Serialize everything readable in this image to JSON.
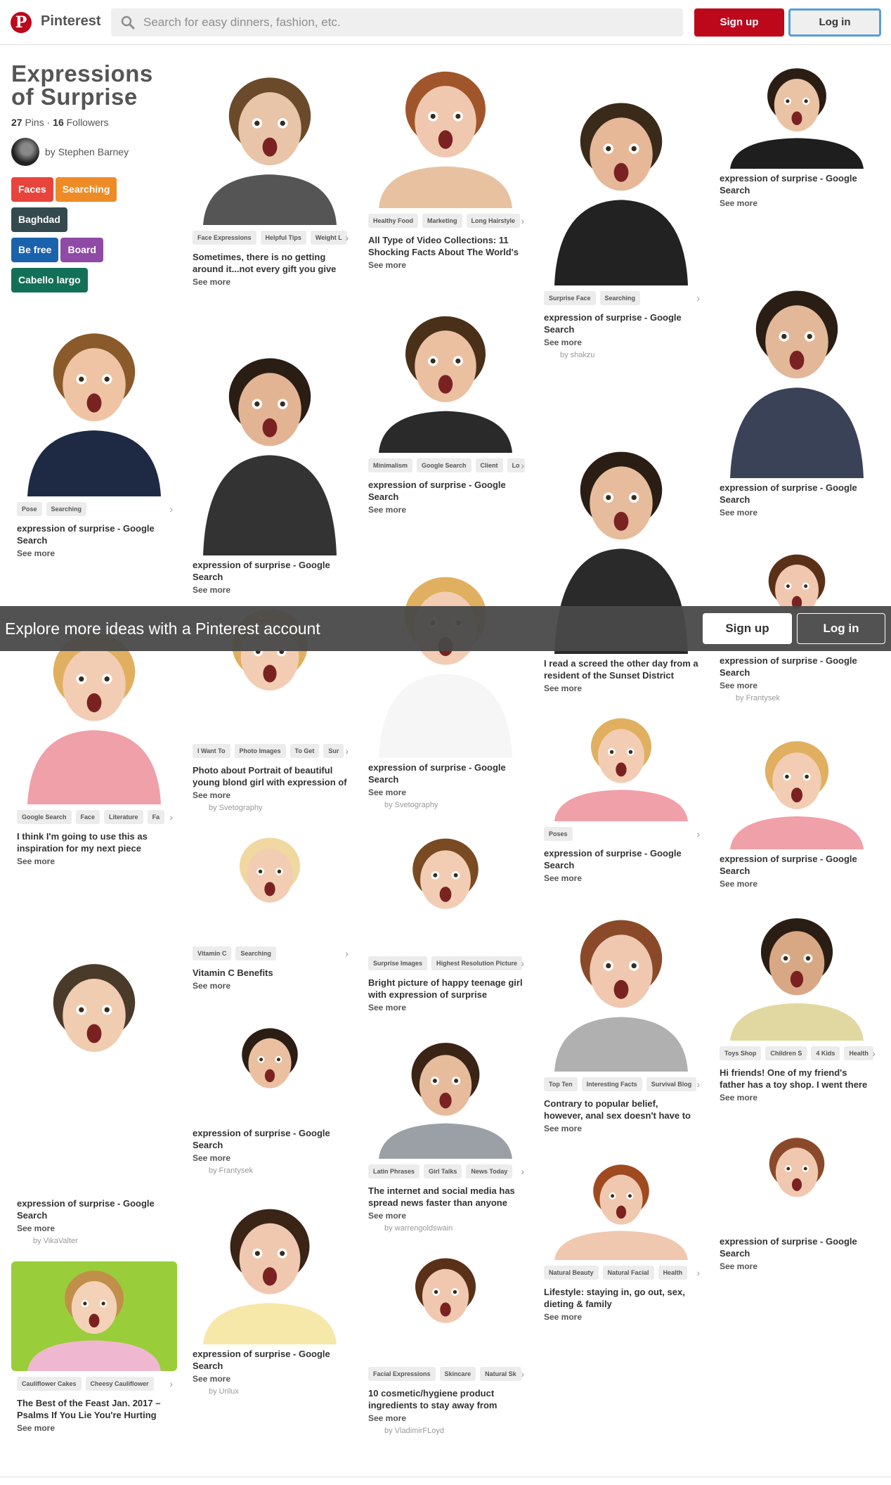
{
  "header": {
    "brand": "Pinterest",
    "search_placeholder": "Search for easy dinners, fashion, etc.",
    "signup": "Sign up",
    "login": "Log in"
  },
  "board": {
    "title": "Expressions of Surprise",
    "pins_count": "27",
    "pins_label": "Pins",
    "separator": " · ",
    "followers_count": "16",
    "followers_label": "Followers",
    "by_prefix": "by ",
    "owner": "Stephen Barney",
    "tags": [
      {
        "label": "Faces",
        "color": "#e9443b"
      },
      {
        "label": "Searching",
        "color": "#ef8b26"
      },
      {
        "label": "Baghdad",
        "color": "#354a4f"
      },
      {
        "label": "Be free",
        "color": "#1a62ab"
      },
      {
        "label": "Board",
        "color": "#8e4aa5"
      },
      {
        "label": "Cabello largo",
        "color": "#137058"
      }
    ]
  },
  "banner": {
    "text": "Explore more ideas with a Pinterest account",
    "signup": "Sign up",
    "login": "Log in"
  },
  "pins": [
    {
      "tags": [
        "Face Expressions",
        "Helpful Tips",
        "Weight L"
      ],
      "desc": "Sometimes, there is no getting around it...not every gift you give",
      "see_more": "See more",
      "by": ""
    },
    {
      "tags": [
        "Healthy Food",
        "Marketing",
        "Long Hairstyle"
      ],
      "desc": "All Type of Video Collections: 11 Shocking Facts About The World's",
      "see_more": "See more",
      "by": ""
    },
    {
      "tags": [
        "Surprise Face",
        "Searching"
      ],
      "desc": "expression of surprise - Google Search",
      "see_more": "See more",
      "by": "by shakzu"
    },
    {
      "tags": [],
      "desc": "expression of surprise - Google Search",
      "see_more": "See more",
      "by": ""
    },
    {
      "tags": [
        "Pose",
        "Searching"
      ],
      "desc": "expression of surprise - Google Search",
      "see_more": "See more",
      "by": ""
    },
    {
      "tags": [],
      "desc": "expression of surprise - Google Search",
      "see_more": "See more",
      "by": ""
    },
    {
      "tags": [
        "Minimalism",
        "Google Search",
        "Client",
        "Lo"
      ],
      "desc": "expression of surprise - Google Search",
      "see_more": "See more",
      "by": ""
    },
    {
      "tags": [],
      "desc": "I read a screed the other day from a resident of the Sunset District",
      "see_more": "See more",
      "by": ""
    },
    {
      "tags": [],
      "desc": "expression of surprise - Google Search",
      "see_more": "See more",
      "by": ""
    },
    {
      "tags": [],
      "desc": "expression of surprise - Google Search",
      "see_more": "See more",
      "by": "by Frantysek"
    },
    {
      "tags": [
        "Google Search",
        "Face",
        "Literature",
        "Fa"
      ],
      "desc": "I think I'm going to use this as inspiration for my next piece",
      "see_more": "See more",
      "by": ""
    },
    {
      "tags": [
        "I Want To",
        "Photo Images",
        "To Get",
        "Sur"
      ],
      "desc": "Photo about Portrait of beautiful young blond girl with expression of",
      "see_more": "See more",
      "by": "by Svetography"
    },
    {
      "tags": [],
      "desc": "expression of surprise - Google Search",
      "see_more": "See more",
      "by": "by Svetography"
    },
    {
      "tags": [
        "Poses"
      ],
      "desc": "expression of surprise - Google Search",
      "see_more": "See more",
      "by": ""
    },
    {
      "tags": [],
      "desc": "expression of surprise - Google Search",
      "see_more": "See more",
      "by": ""
    },
    {
      "tags": [
        "Vitamin C",
        "Searching"
      ],
      "desc": "Vitamin C Benefits",
      "see_more": "See more",
      "by": ""
    },
    {
      "tags": [
        "Surprise Images",
        "Highest Resolution Picture"
      ],
      "desc": "Bright picture of happy teenage girl with expression of surprise",
      "see_more": "See more",
      "by": ""
    },
    {
      "tags": [
        "Toys Shop",
        "Children S",
        "4 Kids",
        "Health"
      ],
      "desc": "Hi friends! One of my friend's father has a toy shop. I went there",
      "see_more": "See more",
      "by": ""
    },
    {
      "tags": [],
      "desc": "expression of surprise - Google Search",
      "see_more": "See more",
      "by": "by VikaValter"
    },
    {
      "tags": [],
      "desc": "expression of surprise - Google Search",
      "see_more": "See more",
      "by": "by Frantysek"
    },
    {
      "tags": [
        "Latin Phrases",
        "Girl Talks",
        "News Today"
      ],
      "desc": "The internet and social media has spread news faster than anyone",
      "see_more": "See more",
      "by": "by warrengoldswain"
    },
    {
      "tags": [
        "Top Ten",
        "Interesting Facts",
        "Survival Blog"
      ],
      "desc": "Contrary to popular belief, however, anal sex doesn't have to",
      "see_more": "See more",
      "by": ""
    },
    {
      "tags": [],
      "desc": "expression of surprise - Google Search",
      "see_more": "See more",
      "by": ""
    },
    {
      "tags": [
        "Natural Beauty",
        "Natural Facial",
        "Health"
      ],
      "desc": "Lifestyle: staying in, go out, sex, dieting & family",
      "see_more": "See more",
      "by": ""
    },
    {
      "tags": [
        "Cauliflower Cakes",
        "Cheesy Cauliflower"
      ],
      "desc": "The Best of the Feast Jan. 2017 – Psalms If You Lie You're Hurting",
      "see_more": "See more",
      "by": ""
    },
    {
      "tags": [],
      "desc": "expression of surprise - Google Search",
      "see_more": "See more",
      "by": "by Urilux"
    },
    {
      "tags": [
        "Facial Expressions",
        "Skincare",
        "Natural Sk"
      ],
      "desc": "10 cosmetic/hygiene product ingredients to stay away from",
      "see_more": "See more",
      "by": "by VladimirFLoyd"
    }
  ]
}
